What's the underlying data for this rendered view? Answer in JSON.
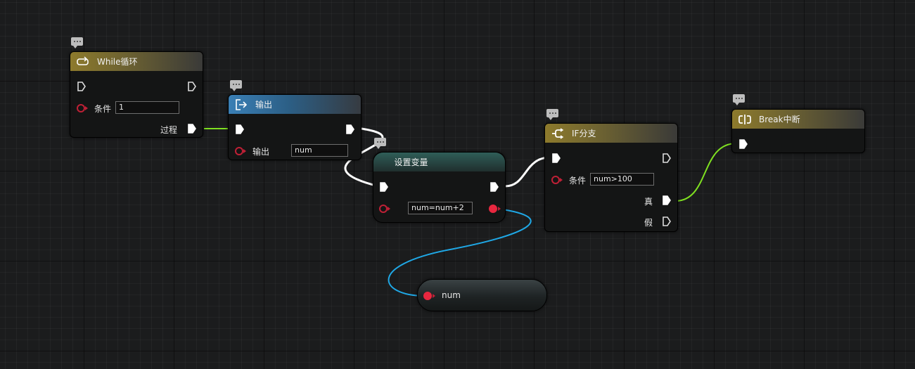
{
  "nodes": {
    "while": {
      "title": "While循环",
      "condition_label": "条件",
      "condition_value": "1",
      "process_label": "过程"
    },
    "output": {
      "title": "输出",
      "param_label": "输出",
      "param_value": "num"
    },
    "set_var": {
      "title": "设置变量",
      "expression_value": "num=num+2"
    },
    "if_branch": {
      "title": "IF分支",
      "condition_label": "条件",
      "condition_value": "num>100",
      "true_label": "真",
      "false_label": "假"
    },
    "break": {
      "title": "Break中断"
    },
    "variable": {
      "name": "num"
    }
  },
  "icons": {
    "while": "loop-icon",
    "output": "exit-icon",
    "if_branch": "branch-icon",
    "break": "break-icon",
    "comment": "comment-bubble-icon"
  },
  "colors": {
    "exec_wire": "#ffffff",
    "active_wire": "#7fe021",
    "data_wire": "#1fa8e6",
    "data_pin": "#e8273f",
    "gold_header": "#8d7a2c",
    "blue_header": "#3a7fb5",
    "teal_header": "#2f5e58"
  }
}
